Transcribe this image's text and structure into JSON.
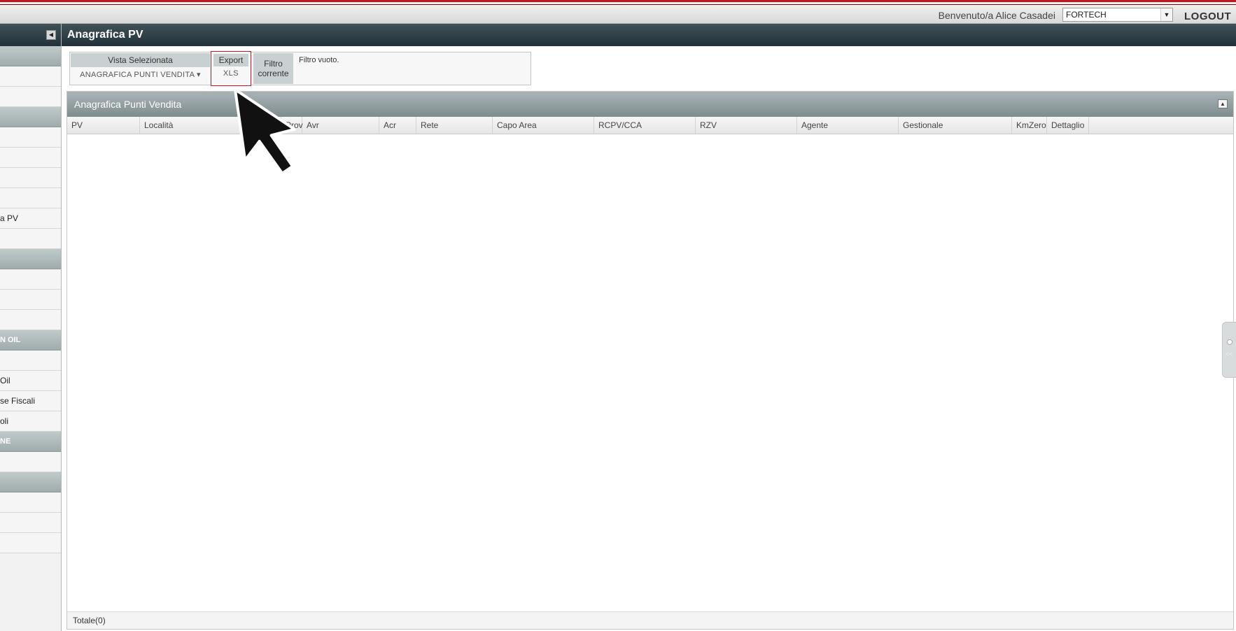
{
  "topbar": {
    "welcome": "Benvenuto/a Alice Casadei",
    "company": "FORTECH",
    "logout": "LOGOUT"
  },
  "sidebar": {
    "items": [
      {
        "label": "",
        "group": true
      },
      {
        "label": "",
        "group": false
      },
      {
        "label": "",
        "group": false
      },
      {
        "label": "",
        "group": true
      },
      {
        "label": "",
        "group": false
      },
      {
        "label": "",
        "group": false
      },
      {
        "label": "",
        "group": false
      },
      {
        "label": "",
        "group": false
      },
      {
        "label": "a PV",
        "group": false
      },
      {
        "label": "",
        "group": false
      },
      {
        "label": "",
        "group": true
      },
      {
        "label": "",
        "group": false
      },
      {
        "label": "",
        "group": false
      },
      {
        "label": "",
        "group": false
      },
      {
        "label": "N OIL",
        "group": true
      },
      {
        "label": "",
        "group": false
      },
      {
        "label": "Oil",
        "group": false
      },
      {
        "label": "se Fiscali",
        "group": false
      },
      {
        "label": "oli",
        "group": false
      },
      {
        "label": "NE",
        "group": true
      },
      {
        "label": "",
        "group": false
      },
      {
        "label": "",
        "group": true
      },
      {
        "label": "",
        "group": false
      },
      {
        "label": "",
        "group": false
      },
      {
        "label": "",
        "group": false
      }
    ]
  },
  "main": {
    "title": "Anagrafica PV"
  },
  "toolbar": {
    "vista_label": "Vista Selezionata",
    "vista_value": "ANAGRAFICA PUNTI VENDITA ▾",
    "export_label": "Export",
    "export_xls": "XLS",
    "filtro_label": "Filtro corrente",
    "filtro_text": "Filtro vuoto."
  },
  "grid": {
    "title": "Anagrafica Punti Vendita",
    "columns": [
      "PV",
      "Località",
      "Prov",
      "Avr",
      "Acr",
      "Rete",
      "Capo Area",
      "RCPV/CCA",
      "RZV",
      "Agente",
      "Gestionale",
      "KmZero",
      "Dettaglio"
    ],
    "rows": [],
    "total": "Totale(0)"
  },
  "colors": {
    "accent_red": "#c4161c",
    "header_dark": "#2d3d44",
    "panel_header": "#95a1a3"
  }
}
